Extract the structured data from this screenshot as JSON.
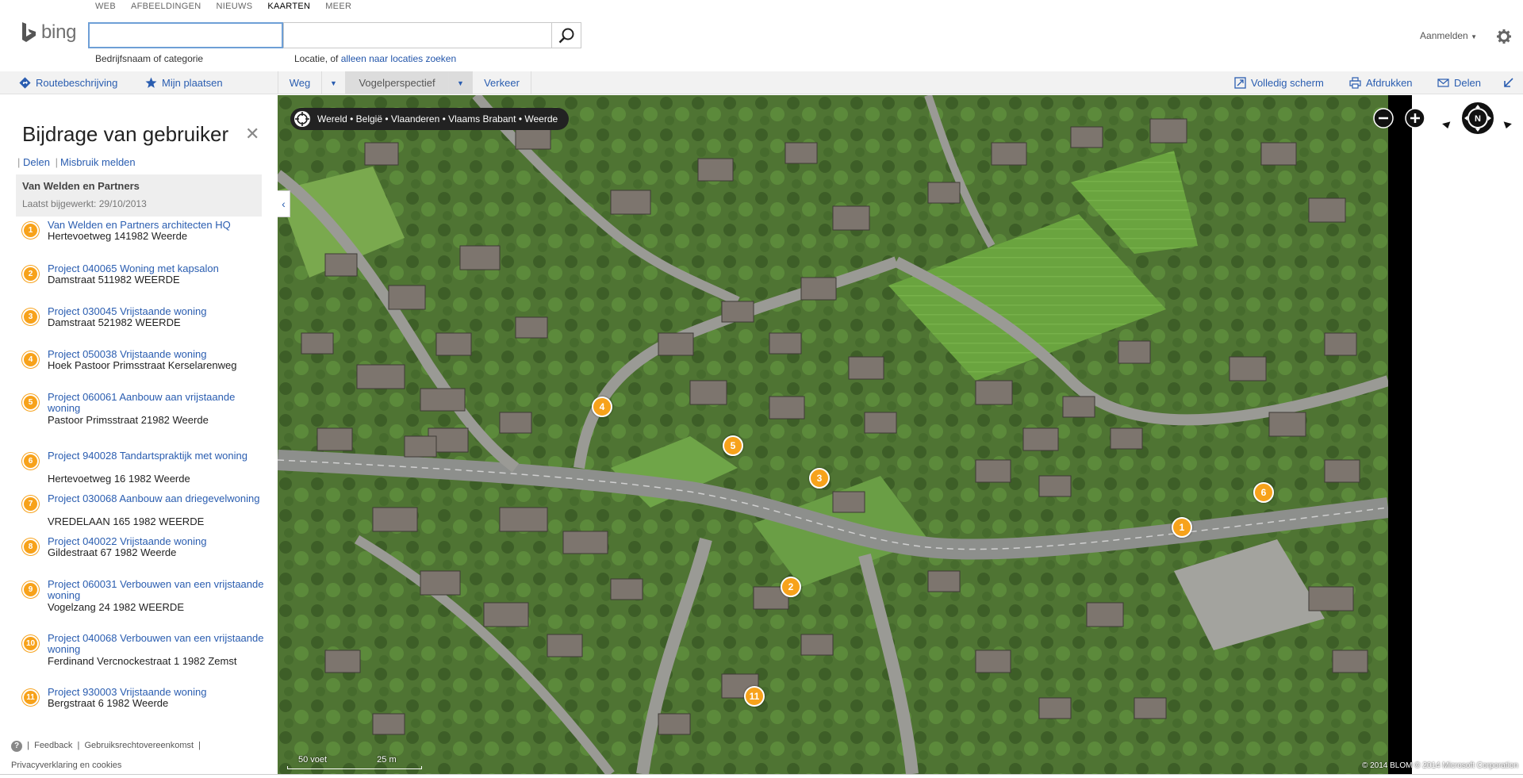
{
  "topnav": [
    "WEB",
    "AFBEELDINGEN",
    "NIEUWS",
    "KAARTEN",
    "MEER"
  ],
  "brand": "bing",
  "search": {
    "what_hint": "Bedrijfsnaam of categorie",
    "where_hint_prefix": "Locatie, of",
    "where_hint_link": "alleen naar locaties zoeken"
  },
  "header": {
    "signin": "Aanmelden"
  },
  "toolbar": {
    "directions": "Routebeschrijving",
    "my_places": "Mijn plaatsen",
    "road": "Weg",
    "birdseye": "Vogelperspectief",
    "traffic": "Verkeer",
    "fullscreen": "Volledig scherm",
    "print": "Afdrukken",
    "share": "Delen"
  },
  "panel": {
    "title": "Bijdrage van gebruiker",
    "share": "Delen",
    "report": "Misbruik melden",
    "business": "Van Welden en Partners",
    "updated": "Laatst bijgewerkt: 29/10/2013",
    "items": [
      {
        "num": "1",
        "title": "Van Welden en Partners architecten HQ",
        "addr": "Hertevoetweg 141982 Weerde"
      },
      {
        "num": "2",
        "title": "Project 040065 Woning met kapsalon",
        "addr": "Damstraat 511982 WEERDE"
      },
      {
        "num": "3",
        "title": "Project 030045 Vrijstaande woning",
        "addr": "Damstraat 521982 WEERDE"
      },
      {
        "num": "4",
        "title": "Project 050038 Vrijstaande woning",
        "addr": "Hoek Pastoor Primsstraat Kerselarenweg"
      },
      {
        "num": "5",
        "title": "Project 060061 Aanbouw aan vrijstaande woning",
        "addr": "Pastoor Primsstraat 21982 Weerde"
      },
      {
        "num": "6",
        "title": "Project 940028 Tandartspraktijk met woning",
        "addr": "Hertevoetweg 16 1982 Weerde"
      },
      {
        "num": "7",
        "title": "Project 030068 Aanbouw aan driegevelwoning",
        "addr": "VREDELAAN 165 1982 WEERDE"
      },
      {
        "num": "8",
        "title": "Project 040022 Vrijstaande woning",
        "addr": "Gildestraat 67 1982 Weerde"
      },
      {
        "num": "9",
        "title": "Project 060031 Verbouwen van een vrijstaande woning",
        "addr": "Vogelzang 24 1982 WEERDE"
      },
      {
        "num": "10",
        "title": "Project 040068 Verbouwen van een vrijstaande woning",
        "addr": "Ferdinand Vercnockestraat 1 1982 Zemst"
      },
      {
        "num": "11",
        "title": "Project 930003 Vrijstaande woning",
        "addr": "Bergstraat 6 1982 Weerde"
      }
    ],
    "footer": {
      "help": "?",
      "feedback": "Feedback",
      "terms": "Gebruiksrechtovereenkomst",
      "privacy": "Privacyverklaring en cookies"
    }
  },
  "map": {
    "breadcrumb": "Wereld • België • Vlaanderen • Vlaams Brabant • Weerde",
    "pins": [
      "4",
      "5",
      "3",
      "6",
      "1",
      "2",
      "11"
    ],
    "scale_feet": "50 voet",
    "scale_meters": "25 m",
    "copyright": "© 2014 BLOM   © 2014 Microsoft Corporation",
    "compass": "N"
  },
  "colors": {
    "link": "#2a5db0",
    "pin": "#f7a21b",
    "toolbar_bg": "#f2f2f2"
  }
}
